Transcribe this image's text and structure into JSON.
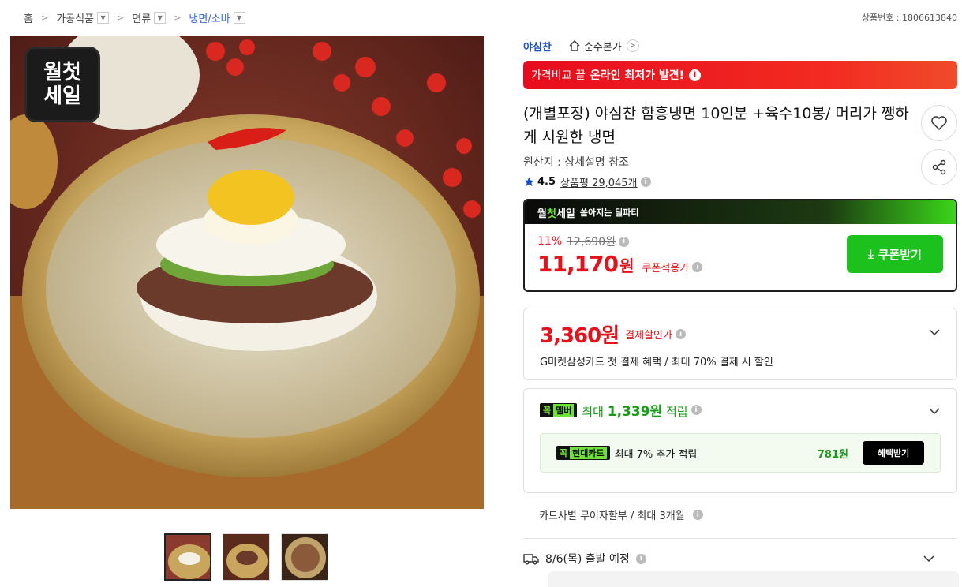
{
  "breadcrumb": {
    "home": "홈",
    "items": [
      "가공식품",
      "면류",
      "냉면/소바"
    ]
  },
  "product_number": "상품번호 : 1806613840",
  "brand": {
    "name": "야심찬",
    "store_label": "순수본가"
  },
  "compare_banner": {
    "prefix": "가격비교 끝",
    "highlight": "온라인 최저가 발견!"
  },
  "product": {
    "title": "(개별포장) 야심찬 함흥냉면 10인분 +육수10봉/ 머리가 쨍하게 시원한 냉면",
    "origin": "원산지 : 상세설명 참조",
    "rating": "4.5",
    "review_label": "상품평",
    "review_count": "29,045개"
  },
  "image_badge": {
    "line1": "월첫",
    "line2": "세일"
  },
  "deal": {
    "badge_prefix": "월",
    "badge_highlight": "첫",
    "badge_suffix": "세일",
    "subtitle": "쏟아지는 딜파티",
    "discount": "11%",
    "original_price": "12,690원",
    "price": "11,170",
    "currency": "원",
    "coupon_label": "쿠폰적용가",
    "coupon_button": "쿠폰받기"
  },
  "cashback": {
    "amount": "3,360원",
    "label": "결제할인가",
    "description": "G마켓삼성카드 첫 결제 혜택 / 최대 70% 결제 시 할인"
  },
  "member": {
    "tag_a": "꼭",
    "tag_b": "멤버",
    "text_prefix": "최대",
    "amount": "1,339원",
    "text_suffix": "적립",
    "sub": {
      "tag_a": "꼭",
      "tag_b": "현대카드",
      "text": "최대 7% 추가 적립",
      "points": "781원",
      "button": "혜택받기"
    }
  },
  "installment": "카드사별 무이자할부 / 최대 3개월",
  "shipping": "8/6(목) 출발 예정",
  "colors": {
    "accent_red": "#e5121c",
    "deal_green": "#1dc11d",
    "brand_blue": "#1a4ec8"
  }
}
